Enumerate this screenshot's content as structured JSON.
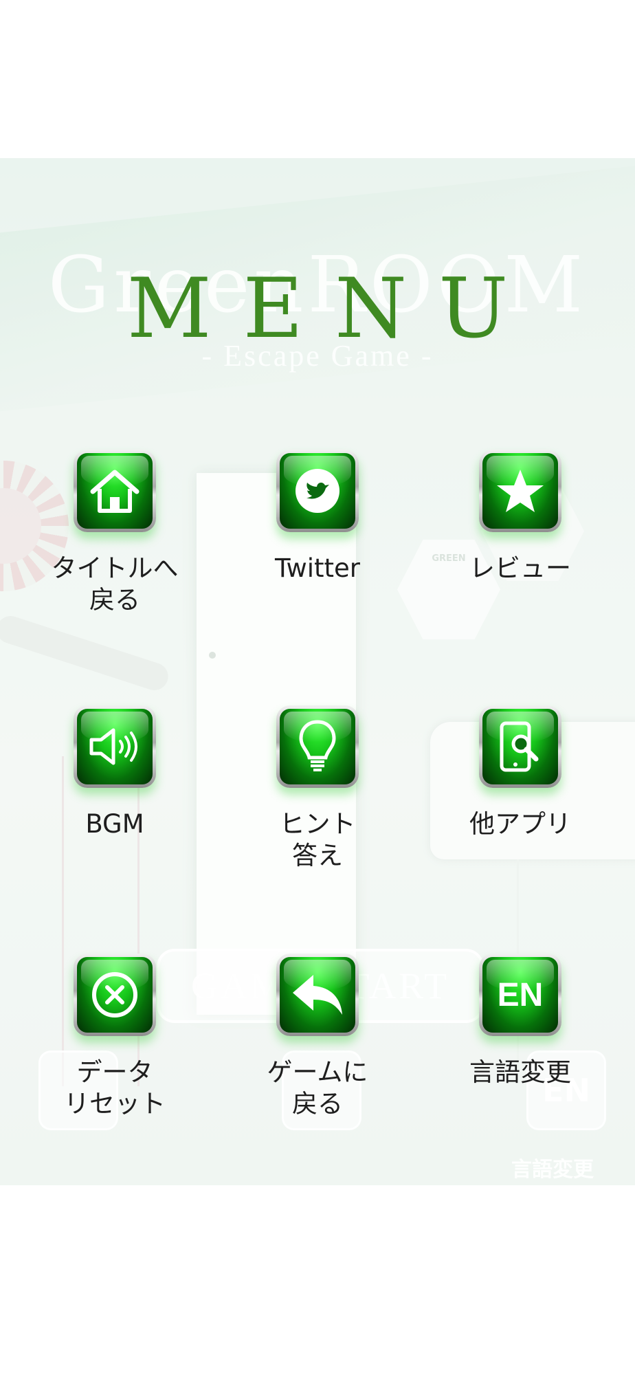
{
  "background": {
    "title": "GreenROOM",
    "subtitle": "- Escape Game -",
    "start_button": "GAME START",
    "hex_label": "GREEN",
    "lang_button_text": "EN",
    "lang_label": "言語変更"
  },
  "menu": {
    "title": "MENU",
    "items": [
      {
        "label": "タイトルへ\n戻る",
        "icon": "home-icon"
      },
      {
        "label": "Twitter",
        "icon": "twitter-icon"
      },
      {
        "label": "レビュー",
        "icon": "star-icon"
      },
      {
        "label": "BGM",
        "icon": "speaker-icon"
      },
      {
        "label": "ヒント\n答え",
        "icon": "lightbulb-icon"
      },
      {
        "label": "他アプリ",
        "icon": "phone-search-icon"
      },
      {
        "label": "データ\nリセット",
        "icon": "close-circle-icon"
      },
      {
        "label": "ゲームに\n戻る",
        "icon": "return-arrow-icon"
      },
      {
        "label": "言語変更",
        "icon": "en-icon",
        "icon_text": "EN"
      }
    ]
  },
  "colors": {
    "menu_title": "#3f8a22",
    "button_green": "#16c41a"
  }
}
